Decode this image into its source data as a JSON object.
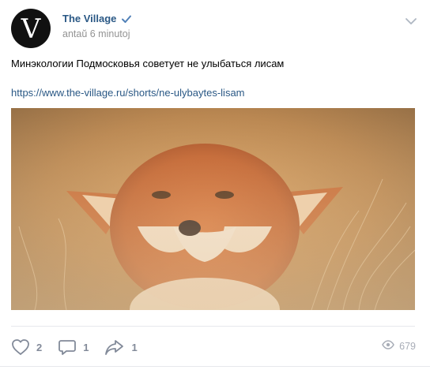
{
  "post": {
    "author": {
      "name": "The Village",
      "avatar_letter": "V",
      "verified": true
    },
    "time": "antaŭ 6 minutoj",
    "text": "Минэкологии Подмосковья советует не улыбаться лисам",
    "link": "https://www.the-village.ru/shorts/ne-ulybaytes-lisam",
    "image_subject": "fox photo",
    "actions": {
      "likes": "2",
      "comments": "1",
      "shares": "1"
    },
    "views": "679"
  },
  "colors": {
    "link": "#2a5885",
    "meta": "#939393",
    "action": "#828a99",
    "views": "#a8adb7",
    "avatar_bg": "#111111"
  },
  "icons": {
    "like": "heart-icon",
    "comment": "comment-icon",
    "share": "share-icon",
    "views": "eye-icon",
    "menu": "chevron-down-icon",
    "verified": "check-icon"
  }
}
